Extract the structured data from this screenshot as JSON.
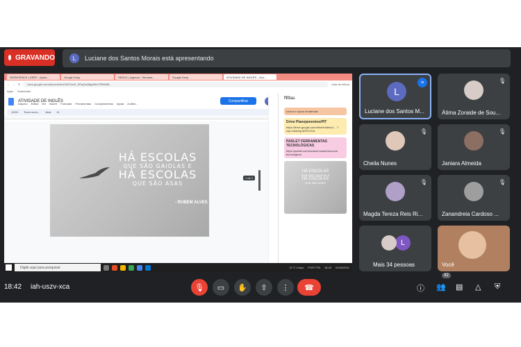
{
  "meet": {
    "recording_label": "GRAVANDO",
    "presenter_initial": "L",
    "presenting_text": "Luciane dos Santos Morais está apresentando",
    "clock": "18:42",
    "meeting_code": "iah-uszv-xca",
    "participant_count": "42"
  },
  "screen": {
    "tabs": [
      "WORKSPACE | KEEP - Apres...",
      "Google Keep",
      "SEDUC | Agenda - Semana...",
      "Google Keep",
      "ATIVIDADE DE INGLÊS - Goo..."
    ],
    "url": "docs.google.com/document/d/1hEOvu0_Sf3yQuQ8gd9eO7RNt5Bl...",
    "bookmarks": [
      "Apps",
      "Scheduled"
    ],
    "reading_list": "Lista de leitura",
    "doc": {
      "title": "ATIVIDADE DE INGLÊS",
      "menu": [
        "Arquivo",
        "Editar",
        "Ver",
        "Inserir",
        "Formatar",
        "Ferramentas",
        "Complementos",
        "Ajuda",
        "A últim..."
      ],
      "share_label": "Compartilhar",
      "avatar": "L",
      "toolbar": [
        "100%",
        "Texto norm...",
        "Arial",
        "11"
      ],
      "page_badge": "1 de 2",
      "quote": {
        "line1": "HÁ ESCOLAS",
        "line2": "QUE SÃO GAIOLAS E",
        "line3": "HÁ ESCOLAS",
        "line4": "QUE SÃO ASAS",
        "author": "- RUBEM ALVES"
      }
    },
    "notes": {
      "keep": "KEEP",
      "title": "Notas",
      "items": [
        {
          "title": "",
          "body": "cursos e apoio #materiais",
          "color": "#f6c6a3"
        },
        {
          "title": "Drive Planejamentos/PIT",
          "body": "https://drive.google.com/drive/folders/1 ...?usp=sharing #ESCOLA",
          "color": "#fdebb0"
        },
        {
          "title": "PADLET FERRAMENTAS TECNOLÓGICAS",
          "body": "https://padlet.com/lucianemorais/recursos-tecnologicos",
          "color": "#f8cde3"
        }
      ],
      "thumb_text": [
        "HÁ ESCOLAS",
        "QUE SÃO GAIOLAS E",
        "HÁ ESCOLAS",
        "QUE SÃO ASAS"
      ]
    },
    "taskbar": {
      "search": "Digite aqui para pesquisar",
      "weather": "21°C Limpo",
      "lang": "POR PTB",
      "time": "18:40",
      "date": "01/06/2021"
    }
  },
  "participants": [
    {
      "name": "Luciane dos Santos M...",
      "initial": "L",
      "color": "#5c6bc0",
      "active": true
    },
    {
      "name": "Átima Zoraide de Sou...",
      "initial": "",
      "color": "#d7ccc8",
      "active": false
    },
    {
      "name": "Cheila Nunes",
      "initial": "",
      "color": "#e0c8b8",
      "active": false
    },
    {
      "name": "Janiara Almeida",
      "initial": "",
      "color": "#8d6e63",
      "active": false
    },
    {
      "name": "Magda Tereza Reis Ri...",
      "initial": "",
      "color": "#b0a0c8",
      "active": false
    },
    {
      "name": "Zanandreia Cardoso ...",
      "initial": "",
      "color": "#9e9e9e",
      "active": false
    },
    {
      "name": "Mais 34 pessoas",
      "initial": "L",
      "color": "#7e57c2",
      "active": false
    },
    {
      "name": "Você",
      "initial": "",
      "color": "#b08060",
      "active": false
    }
  ]
}
